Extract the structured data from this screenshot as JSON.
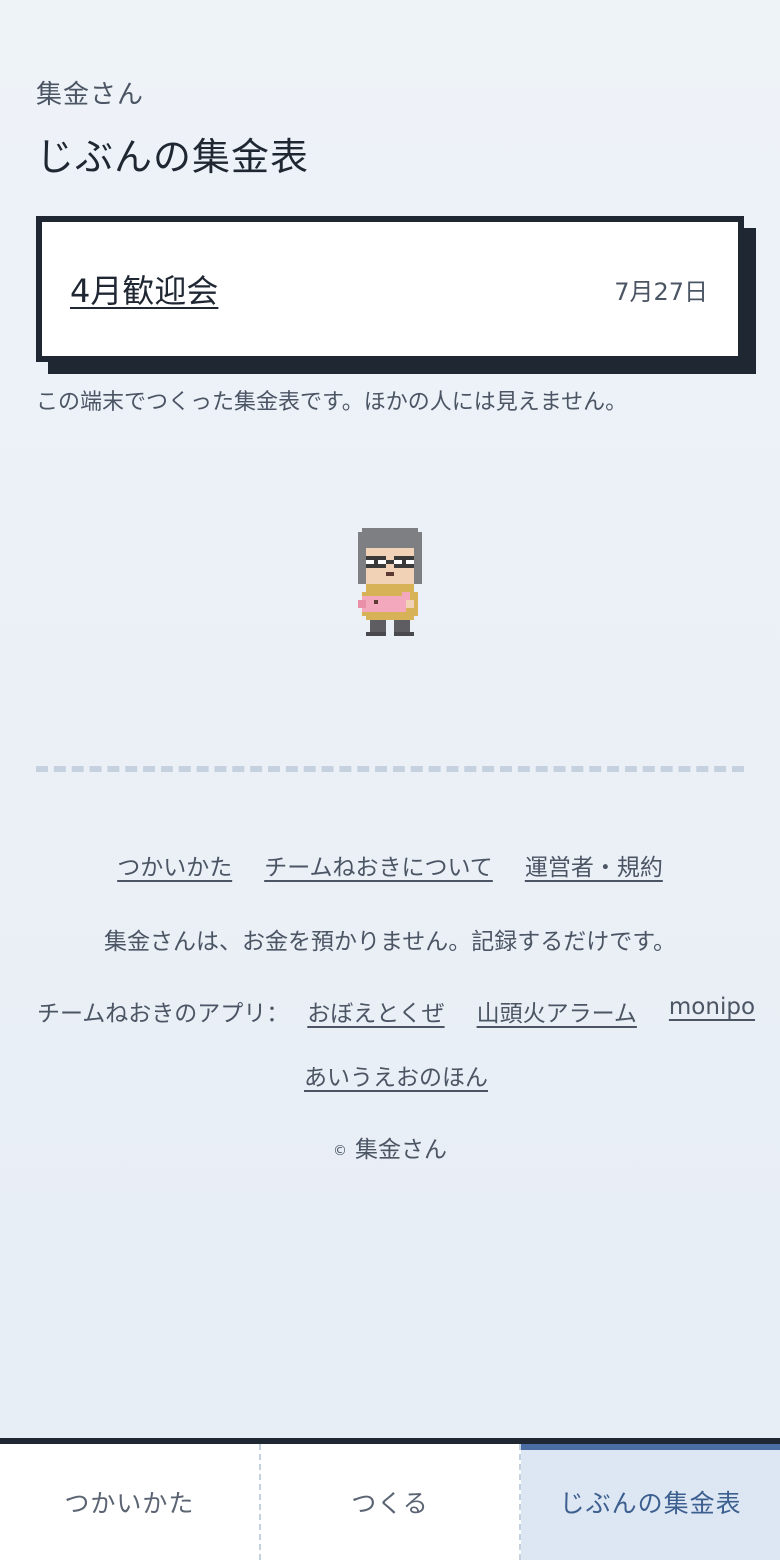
{
  "header": {
    "app_name": "集金さん",
    "page_title": "じぶんの集金表"
  },
  "table_list": [
    {
      "title": "4月歓迎会",
      "date": "7月27日"
    }
  ],
  "notice": "この端末でつくった集金表です。ほかの人には見えません。",
  "footer": {
    "links": [
      "つかいかた",
      "チームねおきについて",
      "運営者・規約"
    ],
    "disclaimer": "集金さんは、お金を預かりません。記録するだけです。",
    "apps_label": "チームねおきのアプリ：",
    "apps": [
      "おぼえとくぜ",
      "山頭火アラーム",
      "monipo",
      "あいうえおのほん"
    ],
    "copyright_symbol": "©",
    "copyright": "集金さん"
  },
  "tabbar": {
    "tabs": [
      {
        "label": "つかいかた",
        "active": false
      },
      {
        "label": "つくる",
        "active": false
      },
      {
        "label": "じぶんの集金表",
        "active": true
      }
    ]
  },
  "colors": {
    "ink": "#1f2733",
    "muted": "#4b5564",
    "active_tab_bg": "#dde7f4",
    "active_tab_accent": "#4a6da3"
  }
}
